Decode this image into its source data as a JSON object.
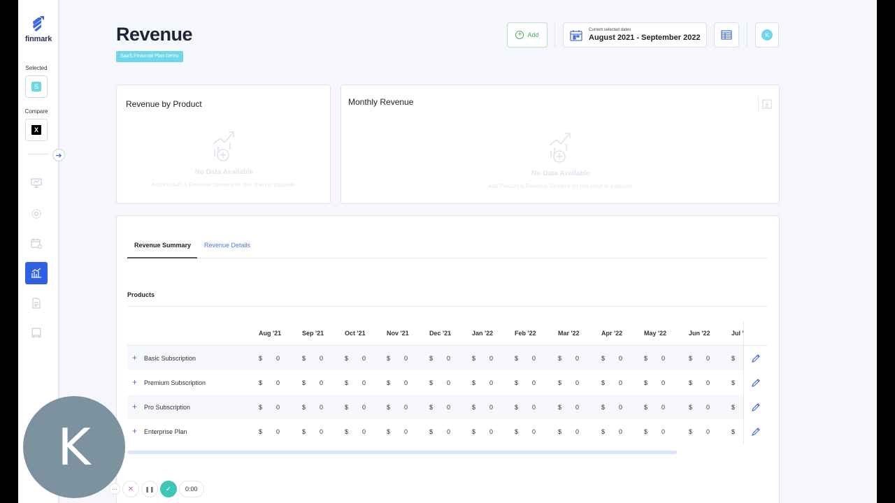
{
  "app": {
    "logo_text": "finmark"
  },
  "sidebar": {
    "selected_label": "Selected",
    "selected_badge": "S",
    "compare_label": "Compare",
    "compare_badge": "X",
    "nav": [
      {
        "name": "dashboard",
        "icon": "monitor-icon"
      },
      {
        "name": "settings",
        "icon": "gear-icon"
      },
      {
        "name": "planning",
        "icon": "calendar-icon"
      },
      {
        "name": "revenue",
        "icon": "chart-icon",
        "active": true
      },
      {
        "name": "reports",
        "icon": "document-icon"
      },
      {
        "name": "presentation",
        "icon": "easel-icon"
      }
    ]
  },
  "header": {
    "title": "Revenue",
    "plan_badge": "SaaS Financial Plan Demo",
    "add_label": "Add",
    "date_caption": "Current selected dates",
    "date_range": "August 2021 - September 2022",
    "user_initial": "K"
  },
  "cards": {
    "by_product": {
      "title": "Revenue by Product",
      "empty_title": "No Data Available",
      "empty_sub": "Add Product & Revenue Streams for this chart to populate."
    },
    "monthly": {
      "title": "Monthly Revenue",
      "empty_title": "No Data Available",
      "empty_sub": "Add Product & Revenue Streams for this chart to populate."
    }
  },
  "tabs": [
    {
      "label": "Revenue Summary",
      "active": true
    },
    {
      "label": "Revenue Details",
      "active": false
    }
  ],
  "table": {
    "section_label": "Products",
    "months": [
      "Aug '21",
      "Sep '21",
      "Oct '21",
      "Nov '21",
      "Dec '21",
      "Jan '22",
      "Feb '22",
      "Mar '22",
      "Apr '22",
      "May '22",
      "Jun '22",
      "Jul '"
    ],
    "currency": "$",
    "rows": [
      {
        "name": "Basic Subscription",
        "values": [
          "0",
          "0",
          "0",
          "0",
          "0",
          "0",
          "0",
          "0",
          "0",
          "0",
          "0",
          ""
        ]
      },
      {
        "name": "Premium Subscription",
        "values": [
          "0",
          "0",
          "0",
          "0",
          "0",
          "0",
          "0",
          "0",
          "0",
          "0",
          "0",
          ""
        ]
      },
      {
        "name": "Pro Subscription",
        "values": [
          "0",
          "0",
          "0",
          "0",
          "0",
          "0",
          "0",
          "0",
          "0",
          "0",
          "0",
          ""
        ]
      },
      {
        "name": "Enterprise Plan",
        "values": [
          "0",
          "0",
          "0",
          "0",
          "0",
          "0",
          "0",
          "0",
          "0",
          "0",
          "0",
          ""
        ]
      }
    ]
  },
  "recorder": {
    "avatar_initial": "K",
    "more_label": "···",
    "cancel_label": "✕",
    "pause_label": "❚❚",
    "done_label": "✓",
    "time": "0:00"
  },
  "colors": {
    "accent": "#2f5fe3",
    "badge": "#6fd7e8",
    "add_green": "#4caf6a",
    "link_blue": "#4a78d6"
  }
}
